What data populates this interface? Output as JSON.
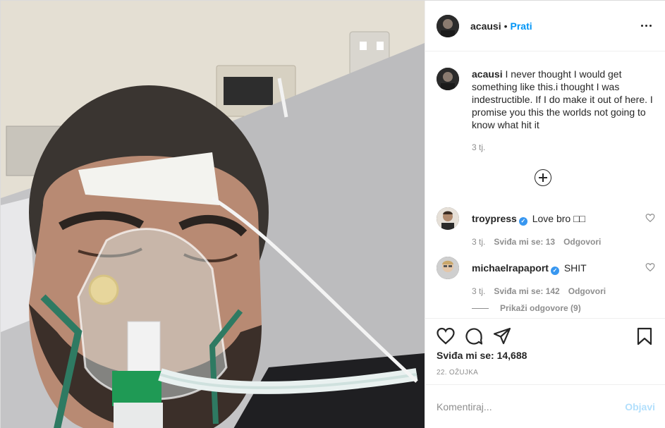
{
  "post": {
    "username": "acausi",
    "separator": "•",
    "follow_label": "Prati",
    "more_icon": "more-options-icon",
    "caption_username": "acausi",
    "caption_text": "I never thought I would get something like this.i thought I was indestructible. If I do make it out of here. I promise you this the worlds not going to know what hit it",
    "caption_time": "3 tj.",
    "load_more_icon": "plus-circle-icon"
  },
  "comments": [
    {
      "username": "troypress",
      "verified": true,
      "text": "Love bro □□",
      "time": "3 tj.",
      "likes": "Sviđa mi se: 13",
      "reply": "Odgovori"
    },
    {
      "username": "michaelrapaport",
      "verified": true,
      "text": "SHIT",
      "time": "3 tj.",
      "likes": "Sviđa mi se: 142",
      "reply": "Odgovori",
      "view_replies": "Prikaži odgovore (9)"
    }
  ],
  "actions": {
    "icons": [
      "heart-icon",
      "comment-icon",
      "share-icon",
      "bookmark-icon"
    ],
    "likes_label": "Sviđa mi se:",
    "likes_count": "14,688",
    "date": "22. OŽUJKA"
  },
  "add_comment": {
    "placeholder": "Komentiraj...",
    "post_label": "Objavi"
  },
  "colors": {
    "link": "#0095f6",
    "muted": "#8e8e8e",
    "verified": "#3897f0",
    "post_disabled": "#b2dffc"
  }
}
